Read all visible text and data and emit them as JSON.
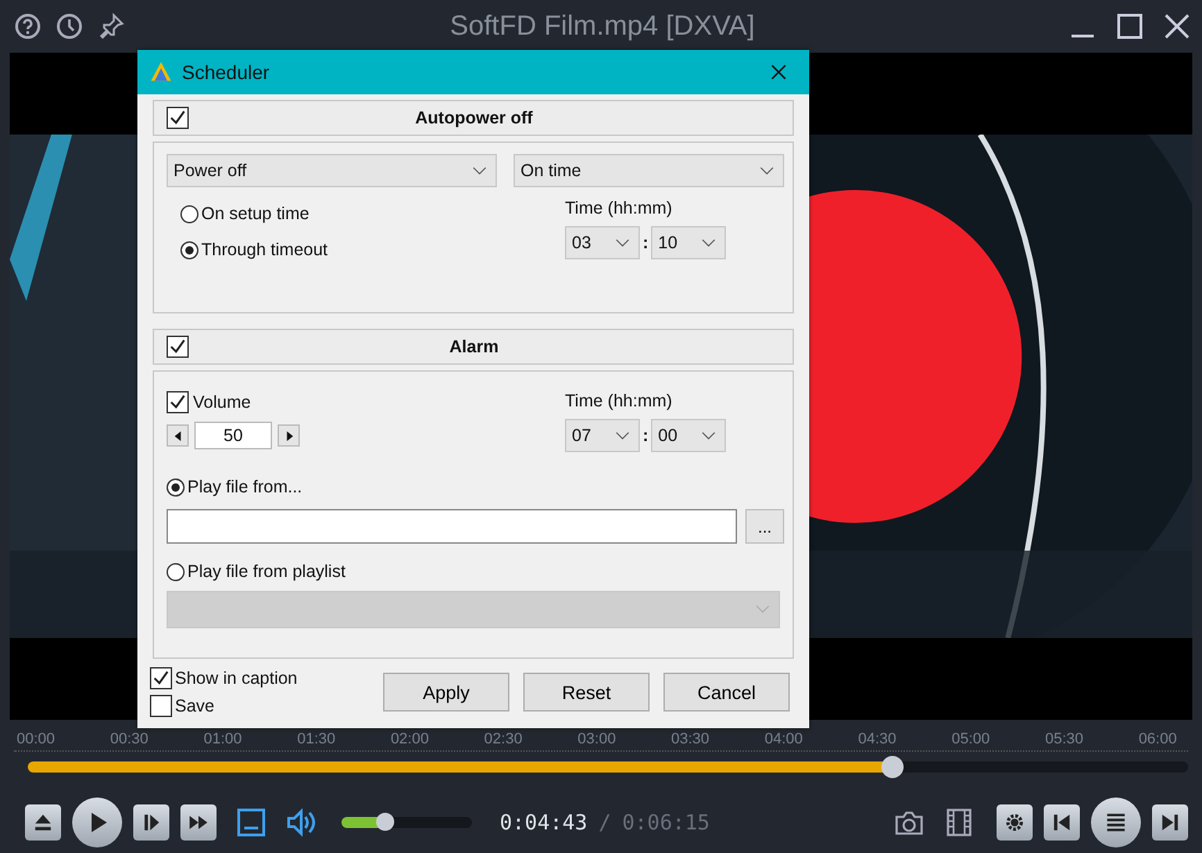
{
  "window": {
    "title": "SoftFD Film.mp4 [DXVA]"
  },
  "timeline": {
    "labels": [
      "00:00",
      "00:30",
      "01:00",
      "01:30",
      "02:00",
      "02:30",
      "03:00",
      "03:30",
      "04:00",
      "04:30",
      "05:00",
      "05:30",
      "06:00"
    ],
    "level": 0.745
  },
  "volume": {
    "level": 0.33
  },
  "time": {
    "current": "0:04:43",
    "separator": "/",
    "total": "0:06:15"
  },
  "dialog": {
    "title": "Scheduler",
    "autopower": {
      "label": "Autopower off",
      "checked": true,
      "action": "Power off",
      "mode": "On time",
      "radios": [
        {
          "label": "On setup time",
          "selected": false
        },
        {
          "label": "Through timeout",
          "selected": true
        }
      ],
      "time_label": "Time (hh:mm)",
      "hour": "03",
      "minute": "10",
      "colon": ":"
    },
    "alarm": {
      "label": "Alarm",
      "checked": true,
      "volume": {
        "label": "Volume",
        "checked": true,
        "value": "50"
      },
      "time_label": "Time (hh:mm)",
      "hour": "07",
      "minute": "00",
      "colon": ":",
      "play_file": {
        "label": "Play file from...",
        "selected": true
      },
      "browse": "...",
      "playlist": {
        "label": "Play file from playlist",
        "selected": false,
        "disabled": true
      }
    },
    "options": [
      {
        "label": "Show in caption",
        "checked": true
      },
      {
        "label": "Save",
        "checked": false
      }
    ],
    "buttons": [
      "Apply",
      "Reset",
      "Cancel"
    ]
  }
}
